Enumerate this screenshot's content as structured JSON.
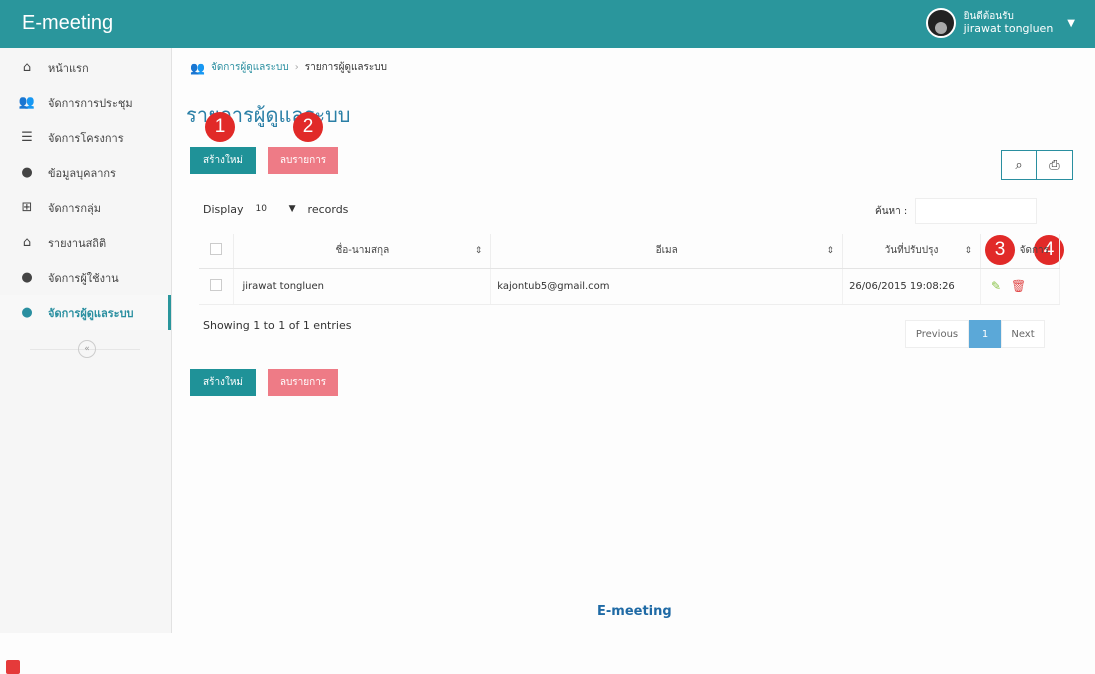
{
  "app": {
    "brand": "E-meeting",
    "footer": "E-meeting"
  },
  "user": {
    "greeting": "ยินดีต้อนรับ",
    "name": "jirawat tongluen"
  },
  "sidebar": {
    "items": [
      {
        "label": "หน้าแรก",
        "icon": "home-icon"
      },
      {
        "label": "จัดการการประชุม",
        "icon": "users-icon"
      },
      {
        "label": "จัดการโครงการ",
        "icon": "list-icon"
      },
      {
        "label": "ข้อมูลบุคลากร",
        "icon": "user-icon"
      },
      {
        "label": "จัดการกลุ่ม",
        "icon": "plus-square-icon"
      },
      {
        "label": "รายงานสถิติ",
        "icon": "report-icon"
      },
      {
        "label": "จัดการผู้ใช้งาน",
        "icon": "user-icon"
      },
      {
        "label": "จัดการผู้ดูแลระบบ",
        "icon": "user-icon",
        "active": true
      }
    ]
  },
  "breadcrumb": {
    "parent": "จัดการผู้ดูแลระบบ",
    "current": "รายการผู้ดูแลระบบ"
  },
  "page": {
    "title": "รายการผู้ดูแลระบบ"
  },
  "buttons": {
    "create": "สร้างใหม่",
    "delete": "ลบรายการ"
  },
  "badges": [
    "1",
    "2",
    "3",
    "4"
  ],
  "table_controls": {
    "display_prefix": "Display",
    "display_value": "10",
    "display_suffix": "records",
    "search_label": "ค้นหา :"
  },
  "table": {
    "headers": {
      "name": "ชื่อ-นามสกุล",
      "email": "อีเมล",
      "updated": "วันที่ปรับปรุง",
      "actions": "จัดการ"
    },
    "rows": [
      {
        "name": "jirawat tongluen",
        "email": "kajontub5@gmail.com",
        "updated": "26/06/2015 19:08:26"
      }
    ]
  },
  "pagination": {
    "info": "Showing 1 to 1 of 1 entries",
    "previous": "Previous",
    "current": "1",
    "next": "Next"
  },
  "colors": {
    "topbar": "#2a969c",
    "primary": "#1f9298",
    "danger": "#ee7b86",
    "badge": "#e12a28",
    "page_active": "#5ba8d8"
  }
}
